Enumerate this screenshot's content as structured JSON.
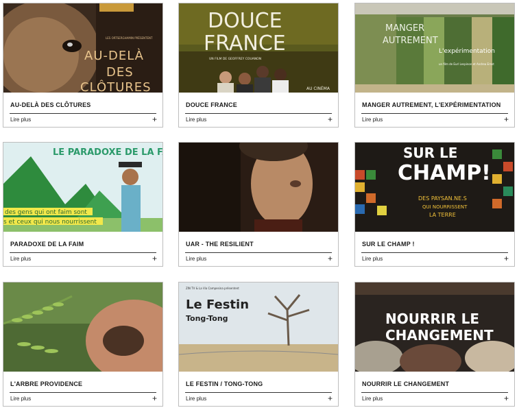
{
  "cards": [
    {
      "title": "AU-DELÀ DES CLÔTURES",
      "more": "Lire plus",
      "poster_lines": [
        "AU-DELÀ",
        "DES",
        "CLÔTURES"
      ],
      "poster_small": "LES ORTSERGHAMIN PRÉSENTENT"
    },
    {
      "title": "DOUCE FRANCE",
      "more": "Lire plus",
      "poster_lines": [
        "DOUCE",
        "FRANCE"
      ],
      "poster_small": "UN FILM DE GEOFFREY COUANON",
      "poster_tag": "AU CINÉMA"
    },
    {
      "title": "MANGER AUTREMENT, L'EXPÉRIMENTATION",
      "more": "Lire plus",
      "poster_lines": [
        "MANGER",
        "AUTREMENT"
      ],
      "poster_sub": "L'expérimentation",
      "poster_small": "un film de Eurl Lespinon et Andrea Ernst"
    },
    {
      "title": "PARADOXE DE LA FAIM",
      "more": "Lire plus",
      "poster_lines": [
        "LE PARADOXE DE LA FA"
      ],
      "poster_caption": [
        "des gens qui ont faim sont",
        "s et ceux qui nous nourrissent"
      ]
    },
    {
      "title": "UAR - THE RESILIENT",
      "more": "Lire plus"
    },
    {
      "title": "SUR LE CHAMP !",
      "more": "Lire plus",
      "poster_lines": [
        "SUR LE",
        "CHAMP!"
      ],
      "poster_sub": [
        "DES PAYSAN.NE.S",
        "QUI NOURRISSENT",
        "LA TERRE"
      ]
    },
    {
      "title": "L'ARBRE PROVIDENCE",
      "more": "Lire plus"
    },
    {
      "title": "LE FESTIN / TONG-TONG",
      "more": "Lire plus",
      "poster_lines": [
        "Le Festin",
        "Tong-Tong"
      ],
      "poster_small": "ZIN TV & La Via Campesina présentent"
    },
    {
      "title": "NOURRIR LE CHANGEMENT",
      "more": "Lire plus",
      "poster_lines": [
        "NOURRIR LE",
        "CHANGEMENT"
      ]
    }
  ],
  "plus_icon": "plus-icon",
  "colors": {
    "border": "#bdbdbd",
    "text": "#1a1a1a",
    "paradoxe_green": "#2e8b3d",
    "paradoxe_title": "#2b9a6a"
  }
}
